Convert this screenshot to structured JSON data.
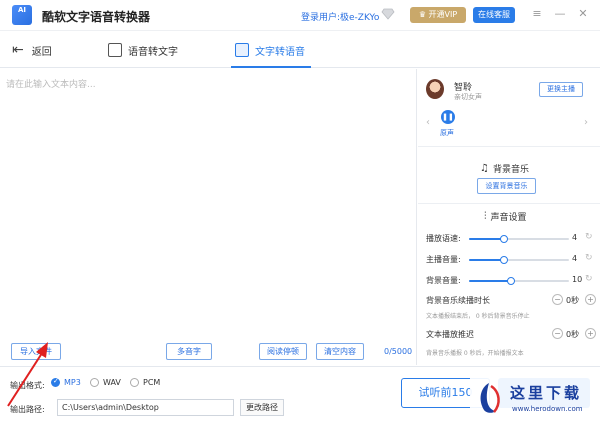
{
  "titlebar": {
    "logo_text": "AI",
    "app_title": "酷软文字语音转换器",
    "login_label": "登录用户:",
    "login_user": "极e-ZKYo",
    "vip_label": "开通VIP",
    "service_label": "在线客服",
    "minimize": "—",
    "close": "✕"
  },
  "nav": {
    "back": "返回",
    "speech_to_text": "语音转文字",
    "text_to_speech": "文字转语音"
  },
  "editor": {
    "placeholder": "请在此输入文本内容...",
    "import_label": "导入文件",
    "polyphone_label": "多音字",
    "pause_label": "阅读停顿",
    "clear_label": "清空内容",
    "char_count": "0/5000"
  },
  "voice": {
    "name": "智聆",
    "desc": "亲切女声",
    "change_label": "更换主播",
    "play_label": "原声",
    "prev": "‹",
    "next": "›"
  },
  "bgm": {
    "title": "背景音乐",
    "set_label": "设置背景音乐"
  },
  "sound": {
    "title": "声音设置",
    "sliders": [
      {
        "label": "播放语速:",
        "value": "4",
        "fraction": 0.35
      },
      {
        "label": "主播音量:",
        "value": "4",
        "fraction": 0.35
      },
      {
        "label": "背景音量:",
        "value": "10",
        "fraction": 0.42
      }
    ],
    "bgm_delay_label": "背景音乐续播时长",
    "bgm_delay_value": "0秒",
    "bgm_delay_hint": "文本播报结束后，  0  秒后背景音乐停止",
    "text_delay_label": "文本播放推迟",
    "text_delay_value": "0秒",
    "text_delay_hint": "背景音乐播报  0 秒后，开始播报文本"
  },
  "output": {
    "format_label": "输出格式:",
    "formats": [
      "MP3",
      "WAV",
      "PCM"
    ],
    "selected_format": "MP3",
    "path_label": "输出路径:",
    "path_value": "C:\\Users\\admin\\Desktop",
    "change_path_label": "更改路径",
    "trial_label": "试听前150"
  },
  "watermark": {
    "cn": "这里下载",
    "url": "www.herodown.com"
  },
  "colors": {
    "accent": "#2a7ce8",
    "vip": "#c9a86a"
  }
}
